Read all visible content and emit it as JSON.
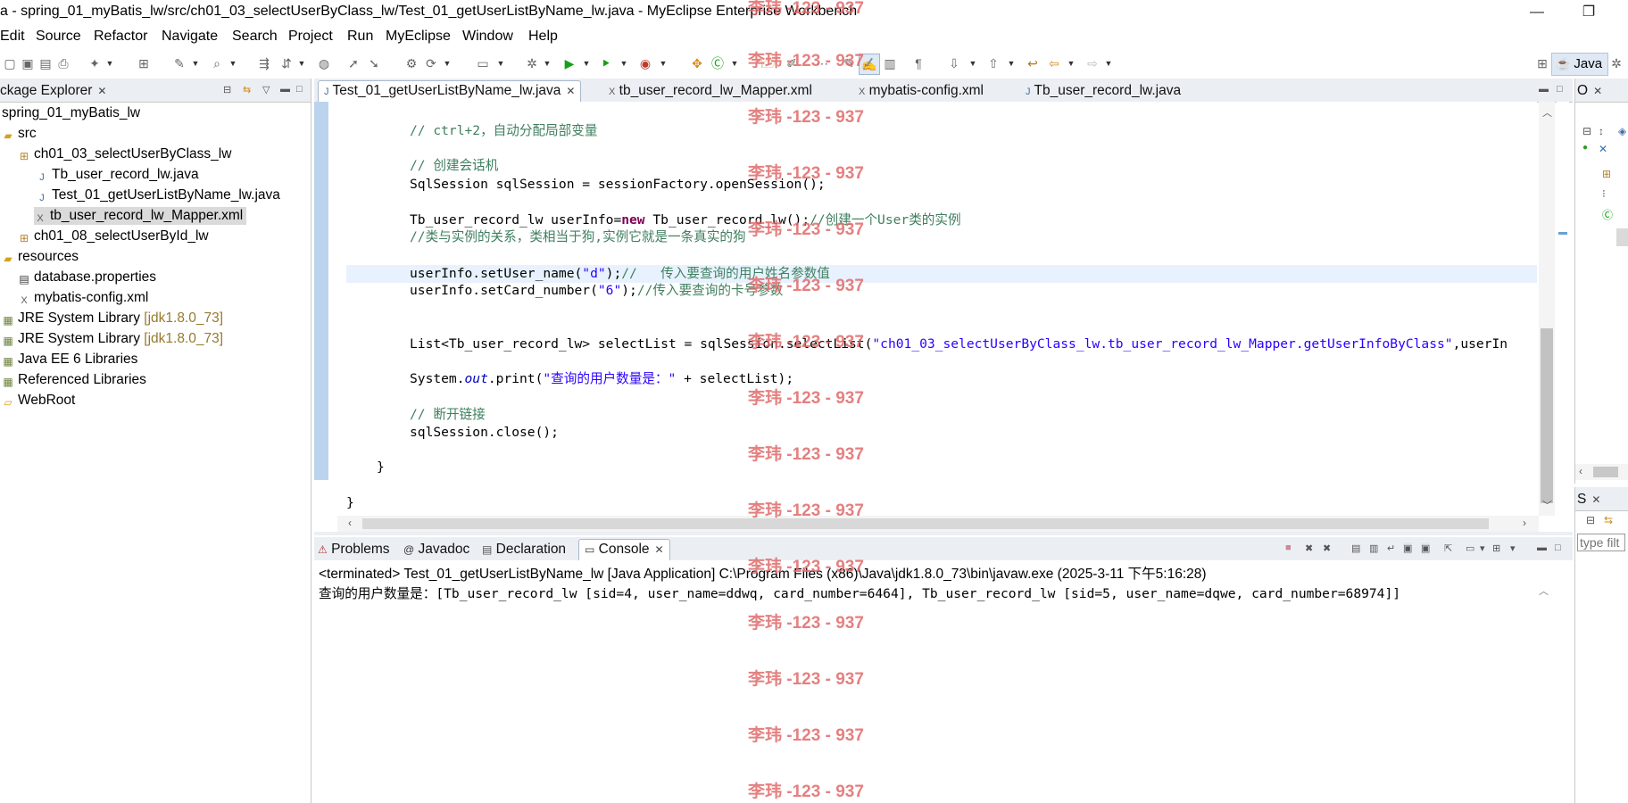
{
  "window": {
    "title": "a - spring_01_myBatis_lw/src/ch01_03_selectUserByClass_lw/Test_01_getUserListByName_lw.java - MyEclipse Enterprise Workbench",
    "minimize": "—",
    "restore": "❐"
  },
  "menu": [
    "Edit",
    "Source",
    "Refactor",
    "Navigate",
    "Search",
    "Project",
    "Run",
    "MyEclipse",
    "Window",
    "Help"
  ],
  "perspective": {
    "label": "Java"
  },
  "package_explorer": {
    "title": "ckage Explorer",
    "items": [
      {
        "label": "spring_01_myBatis_lw",
        "icon": "project-icon",
        "ver": ""
      },
      {
        "label": "src",
        "icon": "folder-icon",
        "ver": ""
      },
      {
        "label": "ch01_03_selectUserByClass_lw",
        "icon": "package-icon",
        "ver": ""
      },
      {
        "label": "Tb_user_record_lw.java",
        "icon": "java-file-icon",
        "ver": ""
      },
      {
        "label": "Test_01_getUserListByName_lw.java",
        "icon": "java-file-icon",
        "ver": ""
      },
      {
        "label": "tb_user_record_lw_Mapper.xml",
        "icon": "xml-file-icon",
        "ver": ""
      },
      {
        "label": "ch01_08_selectUserById_lw",
        "icon": "package-icon",
        "ver": ""
      },
      {
        "label": "resources",
        "icon": "folder-icon",
        "ver": ""
      },
      {
        "label": "database.properties",
        "icon": "properties-file-icon",
        "ver": ""
      },
      {
        "label": "mybatis-config.xml",
        "icon": "xml-file-icon",
        "ver": ""
      },
      {
        "label": "JRE System Library ",
        "icon": "library-icon",
        "ver": "[jdk1.8.0_73]"
      },
      {
        "label": "JRE System Library ",
        "icon": "library-icon",
        "ver": "[jdk1.8.0_73]"
      },
      {
        "label": "Java EE 6 Libraries",
        "icon": "library-icon",
        "ver": ""
      },
      {
        "label": "Referenced Libraries",
        "icon": "library-icon",
        "ver": ""
      },
      {
        "label": "WebRoot",
        "icon": "folder-icon",
        "ver": ""
      }
    ]
  },
  "editor_tabs": [
    {
      "label": "Test_01_getUserListByName_lw.java"
    },
    {
      "label": "tb_user_record_lw_Mapper.xml"
    },
    {
      "label": "mybatis-config.xml"
    },
    {
      "label": "Tb_user_record_lw.java"
    }
  ],
  "code": {
    "l1": "// ctrl+2，自动分配局部变量",
    "l2": "// 创建会话机",
    "l3": "SqlSession sqlSession = sessionFactory.openSession();",
    "l4a": "Tb_user_record_lw userInfo=",
    "l4kw": "new",
    "l4b": " Tb_user_record_lw();",
    "l4c": "//创建一个User类的实例",
    "l5": "//类与实例的关系，类相当于狗,实例它就是一条真实的狗",
    "l6a": "userInfo.setUser_name(",
    "l6s": "\"d\"",
    "l6b": ");",
    "l6c": "//   传入要查询的用户姓名参数值",
    "l7a": "userInfo.setCard_number(",
    "l7s": "\"6\"",
    "l7b": ");",
    "l7c": "//传入要查询的卡号参数",
    "l8a": "List<Tb_user_record_lw> selectList = sqlSession.selectList(",
    "l8s": "\"ch01_03_selectUserByClass_lw.tb_user_record_lw_Mapper.getUserInfoByClass\"",
    "l8b": ",userIn",
    "l9a": "System.",
    "l9i": "out",
    "l9b": ".print(",
    "l9s": "\"查询的用户数量是：\"",
    "l9c": " + selectList);",
    "l10": "// 断开链接",
    "l11": "sqlSession.close();",
    "l12": "}",
    "l13": "}"
  },
  "watermark": "李玮 -123 - 937",
  "bottom_tabs": [
    {
      "label": "Problems",
      "icon": "problems-icon"
    },
    {
      "label": "Javadoc",
      "icon": "javadoc-icon"
    },
    {
      "label": "Declaration",
      "icon": "declaration-icon"
    },
    {
      "label": "Console",
      "icon": "console-icon"
    }
  ],
  "console": {
    "header": "<terminated> Test_01_getUserListByName_lw [Java Application] C:\\Program Files (x86)\\Java\\jdk1.8.0_73\\bin\\javaw.exe (2025-3-11 下午5:16:28)",
    "output": "查询的用户数量是：[Tb_user_record_lw [sid=4, user_name=ddwq, card_number=6464], Tb_user_record_lw [sid=5, user_name=dqwe, card_number=68974]]"
  },
  "outline_panel": {
    "title": "O"
  },
  "right_lower_panel": {
    "title": "S",
    "filter_placeholder": "type filt"
  }
}
